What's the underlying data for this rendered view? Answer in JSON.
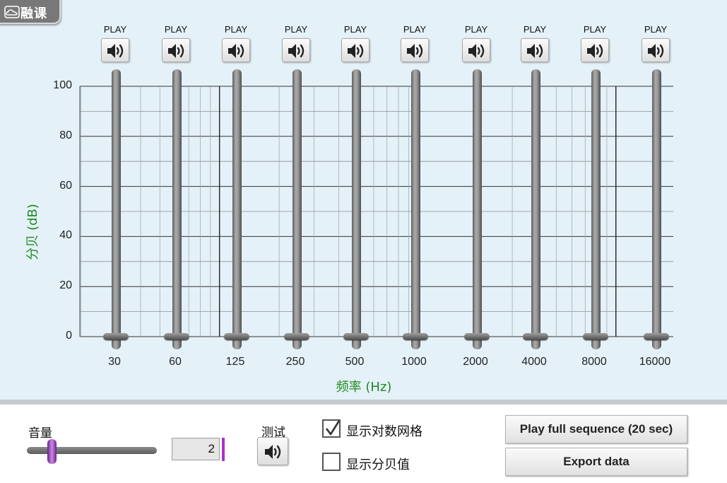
{
  "logo": {
    "text": "融课",
    "icon": "cloud-icon"
  },
  "chart_data": {
    "type": "audiogram",
    "ylabel": "分贝 (dB)",
    "xlabel": "频率 (Hz)",
    "ylim": [
      0,
      100
    ],
    "y_ticks": [
      "100",
      "80",
      "60",
      "40",
      "20",
      "0"
    ],
    "categories": [
      "30",
      "60",
      "125",
      "250",
      "500",
      "1000",
      "2000",
      "4000",
      "8000",
      "16000"
    ],
    "values": [
      0,
      0,
      0,
      0,
      0,
      0,
      0,
      0,
      0,
      0
    ],
    "log_grid": true
  },
  "play": {
    "label": "PLAY",
    "icon": "speaker-icon",
    "buttons": [
      {
        "freq": "30"
      },
      {
        "freq": "60"
      },
      {
        "freq": "125"
      },
      {
        "freq": "250"
      },
      {
        "freq": "500"
      },
      {
        "freq": "1000"
      },
      {
        "freq": "2000"
      },
      {
        "freq": "4000"
      },
      {
        "freq": "8000"
      },
      {
        "freq": "16000"
      }
    ]
  },
  "controls": {
    "volume_label": "音量",
    "volume_value": "2",
    "volume_level": 0.17,
    "test_label": "测试",
    "show_log_grid": {
      "label": "显示对数网格",
      "checked": true
    },
    "show_db_values": {
      "label": "显示分贝值",
      "checked": false
    },
    "play_sequence_label": "Play full sequence (20 sec)",
    "export_label": "Export data"
  },
  "colors": {
    "axis_label": "#1f8a1f",
    "stage_bg": "#e4f1f9",
    "volume_accent": "#a533c9"
  }
}
